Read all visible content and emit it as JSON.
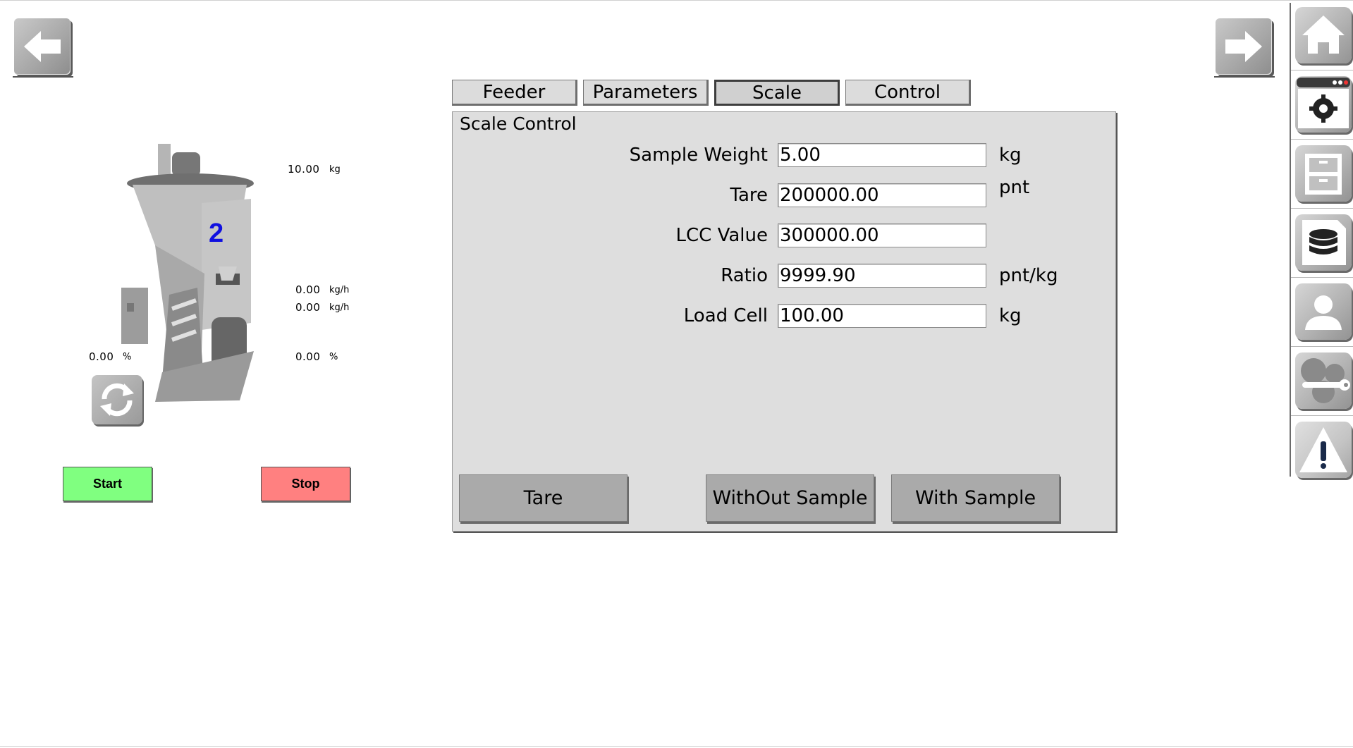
{
  "nav": {
    "back_icon": "arrow-left-icon",
    "forward_icon": "arrow-right-icon"
  },
  "rail": {
    "items": [
      {
        "icon": "home-icon"
      },
      {
        "icon": "settings-window-icon"
      },
      {
        "icon": "file-cabinet-icon"
      },
      {
        "icon": "database-icon"
      },
      {
        "icon": "user-icon"
      },
      {
        "icon": "tools-icon"
      },
      {
        "icon": "alarm-warning-icon"
      }
    ]
  },
  "feeder": {
    "number": "2",
    "weight_value": "10.00",
    "weight_unit": "kg",
    "rate1_value": "0.00",
    "rate1_unit": "kg/h",
    "rate2_value": "0.00",
    "rate2_unit": "kg/h",
    "left_pct_value": "0.00",
    "left_pct_unit": "%",
    "right_pct_value": "0.00",
    "right_pct_unit": "%",
    "start_label": "Start",
    "stop_label": "Stop",
    "start_color": "#80ff80",
    "stop_color": "#ff8080"
  },
  "tabs": [
    {
      "label": "Feeder",
      "active": false
    },
    {
      "label": "Parameters",
      "active": false
    },
    {
      "label": "Scale",
      "active": true
    },
    {
      "label": "Control",
      "active": false
    }
  ],
  "scale": {
    "title": "Scale Control",
    "fields": [
      {
        "label": "Sample Weight",
        "value": "5.00",
        "unit": "kg"
      },
      {
        "label": "Tare",
        "value": "200000.00",
        "unit": "pnt"
      },
      {
        "label": "LCC Value",
        "value": "300000.00",
        "unit": ""
      },
      {
        "label": "Ratio",
        "value": "9999.90",
        "unit": "pnt/kg"
      },
      {
        "label": "Load Cell",
        "value": "100.00",
        "unit": "kg"
      }
    ],
    "buttons": {
      "tare": "Tare",
      "without_sample": "WithOut Sample",
      "with_sample": "With Sample"
    }
  }
}
